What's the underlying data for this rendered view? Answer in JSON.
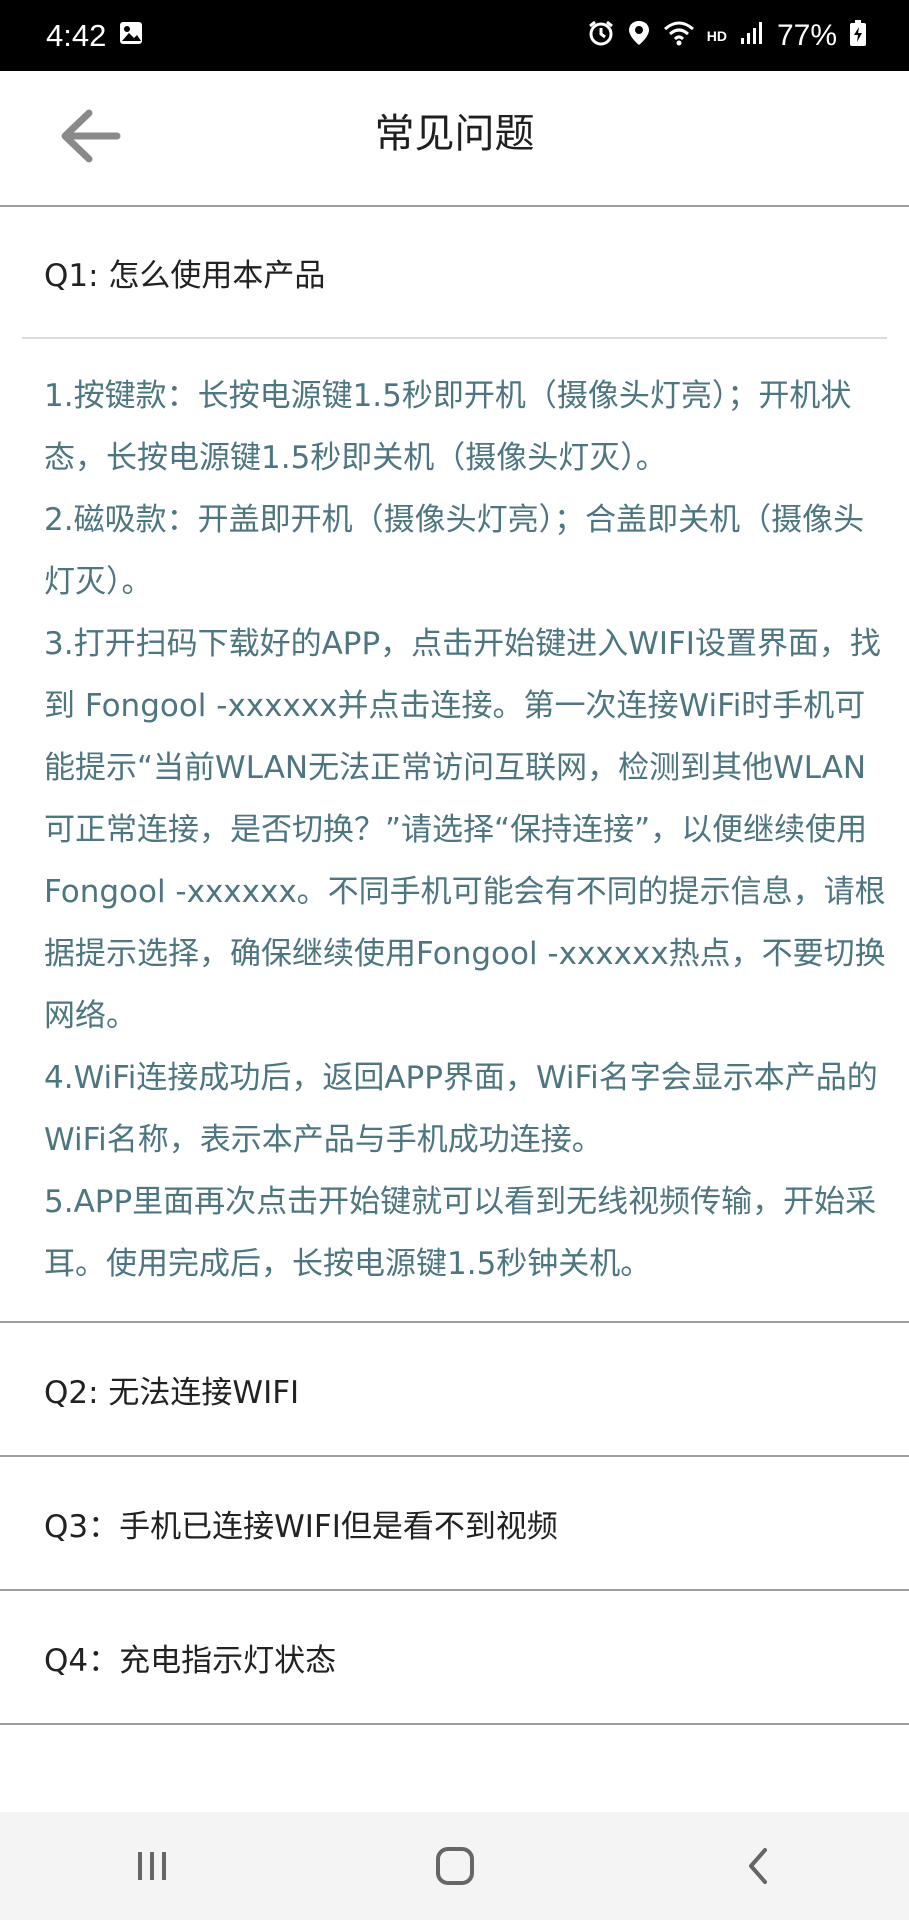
{
  "status_bar": {
    "time": "4:42",
    "hd": "HD",
    "battery": "77%",
    "icons": [
      "image-icon",
      "alarm-icon",
      "location-icon",
      "wifi-icon",
      "signal-icon",
      "battery-icon"
    ]
  },
  "header": {
    "title": "常见问题",
    "back_icon": "arrow-left-icon"
  },
  "faq": {
    "q1": {
      "question": "Q1: 怎么使用本产品",
      "answer": [
        "1.按键款：长按电源键1.5秒即开机（摄像头灯亮）；开机状态，长按电源键1.5秒即关机（摄像头灯灭）。",
        "2.磁吸款：开盖即开机（摄像头灯亮）；合盖即关机（摄像头灯灭）。",
        "3.打开扫码下载好的APP，点击开始键进入WIFI设置界面，找到 Fongool -xxxxxx并点击连接。第一次连接WiFi时手机可能提示“当前WLAN无法正常访问互联网，检测到其他WLAN可正常连接，是否切换？”请选择“保持连接”，以便继续使用Fongool -xxxxxx。不同手机可能会有不同的提示信息，请根据提示选择，确保继续使用Fongool -xxxxxx热点，不要切换网络。",
        "4.WiFi连接成功后，返回APP界面，WiFi名字会显示本产品的WiFi名称，表示本产品与手机成功连接。",
        "5.APP里面再次点击开始键就可以看到无线视频传输，开始采耳。使用完成后，长按电源键1.5秒钟关机。"
      ]
    },
    "q2": "Q2: 无法连接WIFI",
    "q3": "Q3：手机已连接WIFI但是看不到视频",
    "q4": "Q4：充电指示灯状态",
    "answer_color": "#4e7680"
  },
  "nav": {
    "icons": [
      "recent-apps-icon",
      "home-icon",
      "back-icon"
    ]
  }
}
